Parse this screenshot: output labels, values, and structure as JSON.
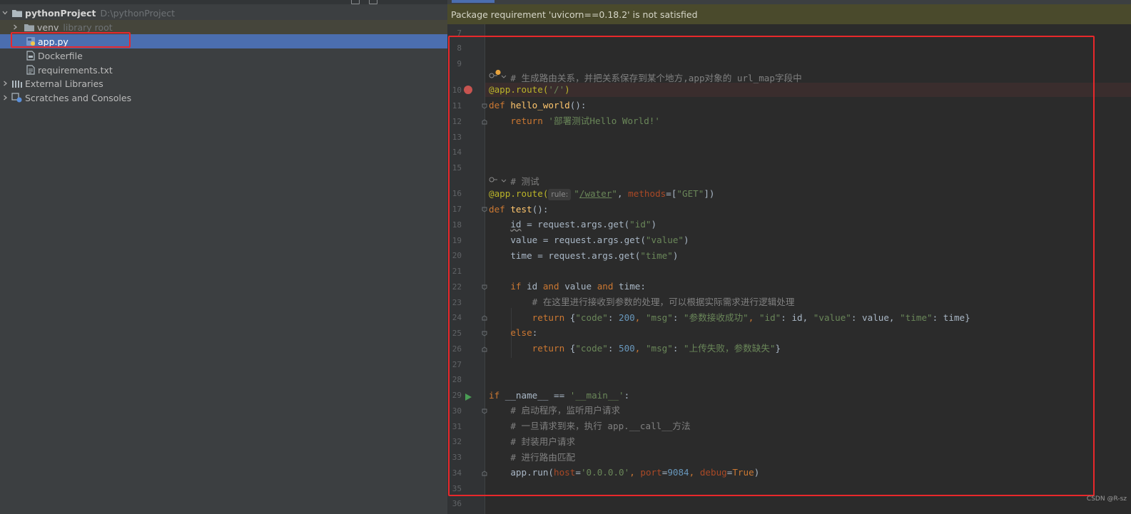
{
  "project_tree": {
    "root": {
      "name": "pythonProject",
      "path": "D:\\pythonProject"
    },
    "items": [
      {
        "name": "venv",
        "note": "library root"
      },
      {
        "name": "app.py"
      },
      {
        "name": "Dockerfile"
      },
      {
        "name": "requirements.txt"
      }
    ],
    "external_libraries": "External Libraries",
    "scratches": "Scratches and Consoles"
  },
  "editor": {
    "warning": "Package requirement 'uvicorn==0.18.2' is not satisfied",
    "line_numbers": [
      "7",
      "8",
      "9",
      "10",
      "11",
      "12",
      "13",
      "14",
      "15",
      "16",
      "17",
      "18",
      "19",
      "20",
      "21",
      "22",
      "23",
      "24",
      "25",
      "26",
      "27",
      "28",
      "29",
      "30",
      "31",
      "32",
      "33",
      "34",
      "35",
      "36"
    ],
    "inlay_hint": "rule:",
    "code": {
      "l9_comment": "# 生成路由关系，并把关系保存到某个地方,app对象的 url_map字段中",
      "l10_deco": "@app.route(",
      "l10_str": "'/'",
      "l10_close": ")",
      "l11_def": "def ",
      "l11_fn": "hello_world",
      "l11_rest": "():",
      "l12_return": "return ",
      "l12_str": "'部署测试Hello World!'",
      "l15_comment": "# 测试",
      "l16_deco": "@app.route(",
      "l16_str_q1": "\"",
      "l16_str_path": "/water",
      "l16_str_q2": "\"",
      "l16_comma": ", ",
      "l16_param": "methods",
      "l16_eq": "=[",
      "l16_get": "\"GET\"",
      "l16_close": "])",
      "l17_def": "def ",
      "l17_fn": "test",
      "l17_rest": "():",
      "l18_id": "id",
      "l18_rest": " = request.args.get(",
      "l18_str": "\"id\"",
      "l18_close": ")",
      "l19_a": "value = request.args.get(",
      "l19_str": "\"value\"",
      "l19_close": ")",
      "l20_a": "time = request.args.get(",
      "l20_str": "\"time\"",
      "l20_close": ")",
      "l22_if": "if ",
      "l22_a": "id ",
      "l22_and1": "and ",
      "l22_b": "value ",
      "l22_and2": "and ",
      "l22_c": "time:",
      "l23_comment": "# 在这里进行接收到参数的处理，可以根据实际需求进行逻辑处理",
      "l24_return": "return ",
      "l24_open": "{",
      "l24_k1": "\"code\"",
      "l24_colon1": ": ",
      "l24_v1": "200",
      "l24_sep1": ", ",
      "l24_k2": "\"msg\"",
      "l24_colon2": ": ",
      "l24_v2": "\"参数接收成功\"",
      "l24_sep2": ", ",
      "l24_k3": "\"id\"",
      "l24_v3": ": id, ",
      "l24_k4": "\"value\"",
      "l24_v4": ": value, ",
      "l24_k5": "\"time\"",
      "l24_v5": ": time}",
      "l25_else": "else",
      "l25_colon": ":",
      "l26_return": "return ",
      "l26_open": "{",
      "l26_k1": "\"code\"",
      "l26_colon1": ": ",
      "l26_v1": "500",
      "l26_sep1": ", ",
      "l26_k2": "\"msg\"",
      "l26_colon2": ": ",
      "l26_v2": "\"上传失败，参数缺失\"",
      "l26_close": "}",
      "l29_if": "if ",
      "l29_name": "__name__",
      "l29_eq": " == ",
      "l29_str": "'__main__'",
      "l29_colon": ":",
      "l30_comment": "# 启动程序，监听用户请求",
      "l31_comment": "# 一旦请求到来，执行 app.__call__方法",
      "l32_comment": "# 封装用户请求",
      "l33_comment": "# 进行路由匹配",
      "l34_a": "app.run(",
      "l34_p1": "host",
      "l34_eq1": "=",
      "l34_v1": "'0.0.0.0'",
      "l34_sep1": ", ",
      "l34_p2": "port",
      "l34_eq2": "=",
      "l34_v2": "9084",
      "l34_sep2": ", ",
      "l34_p3": "debug",
      "l34_eq3": "=",
      "l34_v3": "True",
      "l34_close": ")"
    }
  },
  "watermark": "CSDN @R-sz",
  "colors": {
    "selection": "#4b6eaf",
    "highlight_box": "#e8282b",
    "warning_bg": "#4a4a2c"
  }
}
